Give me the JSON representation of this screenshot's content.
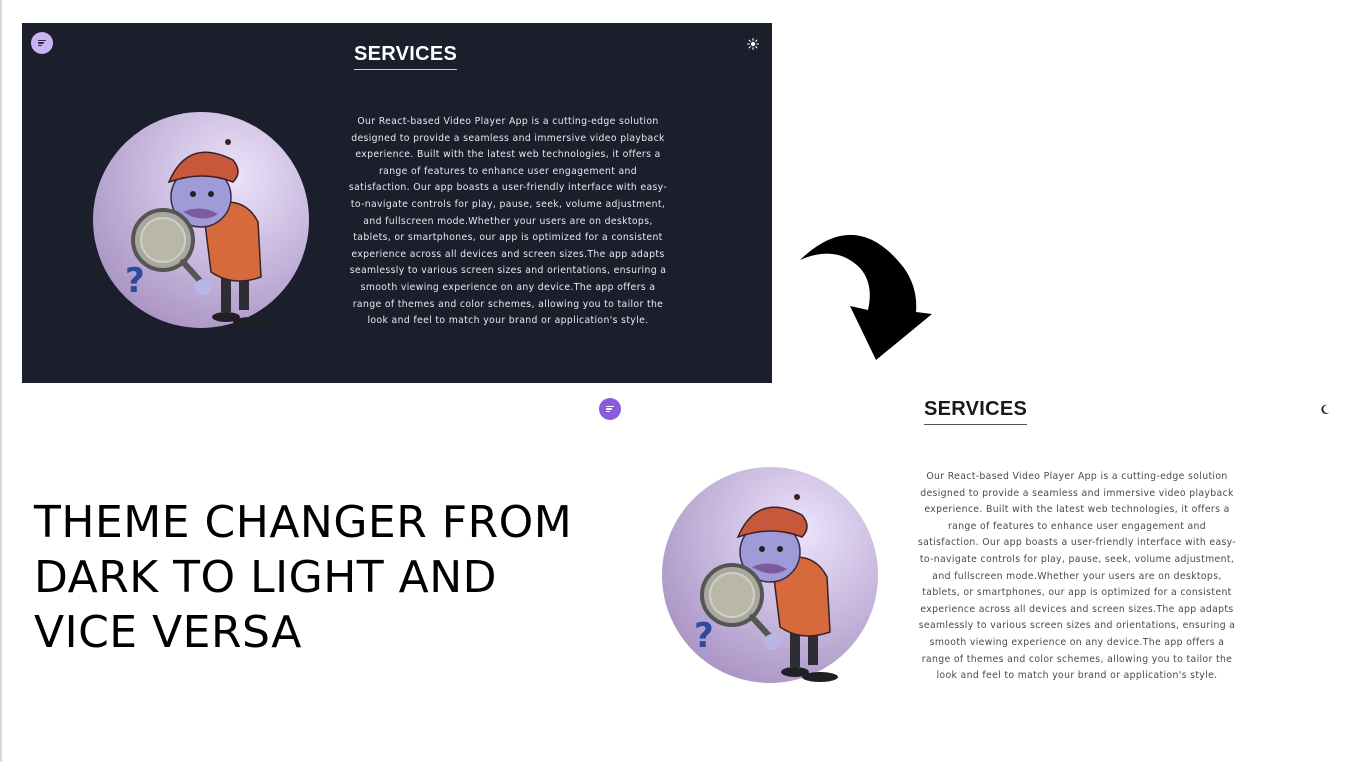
{
  "dark_view": {
    "title": "SERVICES",
    "theme_icon": "sun-icon",
    "menu_icon": "menu-icon",
    "description": "Our React-based Video Player App is a cutting-edge solution designed to provide a seamless and immersive video playback experience. Built with the latest web technologies, it offers a range of features to enhance user engagement and satisfaction. Our app boasts a user-friendly interface with easy-to-navigate controls for play, pause, seek, volume adjustment, and fullscreen mode.Whether your users are on desktops, tablets, or smartphones, our app is optimized for a consistent experience across all devices and screen sizes.The app adapts seamlessly to various screen sizes and orientations, ensuring a smooth viewing experience on any device.The app offers a range of themes and color schemes, allowing you to tailor the look and feel to match your brand or application's style.",
    "colors": {
      "background": "#1b1f2c",
      "text": "#e8e8ee",
      "menu_button": "#c9b3f3"
    }
  },
  "light_view": {
    "title": "SERVICES",
    "theme_icon": "moon-icon",
    "menu_icon": "menu-icon",
    "description": "Our React-based Video Player App is a cutting-edge solution designed to provide a seamless and immersive video playback experience. Built with the latest web technologies, it offers a range of features to enhance user engagement and satisfaction. Our app boasts a user-friendly interface with easy-to-navigate controls for play, pause, seek, volume adjustment, and fullscreen mode.Whether your users are on desktops, tablets, or smartphones, our app is optimized for a consistent experience across all devices and screen sizes.The app adapts seamlessly to various screen sizes and orientations, ensuring a smooth viewing experience on any device.The app offers a range of themes and color schemes, allowing you to tailor the look and feel to match your brand or application's style.",
    "colors": {
      "background": "#ffffff",
      "text": "#4a4a4a",
      "menu_button": "#8a5bdc"
    }
  },
  "caption": "THEME CHANGER FROM DARK TO LIGHT AND VICE VERSA",
  "illustration": "detective-with-magnifying-glass",
  "transition_icon": "curved-arrow-icon"
}
